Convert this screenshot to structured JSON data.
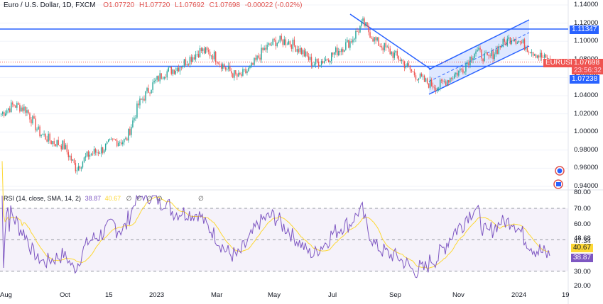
{
  "legend": {
    "symbol": "Euro / U.S. Dollar, 1D, FXCM",
    "open": "O1.07720",
    "high": "H1.07720",
    "low": "L1.07692",
    "close": "C1.07698",
    "change": "-0.00022 (-0.02%)"
  },
  "rsi_legend": {
    "title": "RSI (14, close, SMA, 14, 2)",
    "rsi": "38.87",
    "ma": "40.67",
    "empty": "∅ ∅ ∅ ∅",
    "empty2": "∅"
  },
  "price_axis": [
    "1.14000",
    "1.12000",
    "1.10000",
    "1.08000",
    "1.06000",
    "1.04000",
    "1.02000",
    "1.00000",
    "0.98000",
    "0.96000",
    "0.94000"
  ],
  "rsi_axis": [
    "80.00",
    "70.00",
    "60.00",
    "48.68",
    "47.34",
    "30.00",
    "20.00"
  ],
  "time_axis": [
    "Aug",
    "Oct",
    "15",
    "2023",
    "Mar",
    "May",
    "Jul",
    "Sep",
    "Nov",
    "2024",
    "19"
  ],
  "tags": {
    "resistance": "1.11347",
    "symbol": "EURUSD",
    "price": "1.07698",
    "countdown": "23:56:32",
    "support": "1.07238",
    "rsi": "38.87",
    "rsi_ma": "40.67"
  },
  "colors": {
    "up": "#26a69a",
    "down": "#ef5350",
    "line": "#2962ff",
    "rsi": "#7e57c2",
    "ma": "#fdd835"
  },
  "price_path": [
    1.02,
    1.03,
    1.025,
    1.0,
    0.99,
    0.985,
    0.96,
    0.975,
    0.98,
    0.99,
    0.99,
    1.03,
    1.05,
    1.065,
    1.07,
    1.08,
    1.09,
    1.085,
    1.07,
    1.06,
    1.07,
    1.09,
    1.1,
    1.1,
    1.09,
    1.075,
    1.08,
    1.09,
    1.1,
    1.12,
    1.1,
    1.09,
    1.08,
    1.065,
    1.055,
    1.05,
    1.06,
    1.07,
    1.09,
    1.08,
    1.095,
    1.105,
    1.095,
    1.085,
    1.077
  ]
}
